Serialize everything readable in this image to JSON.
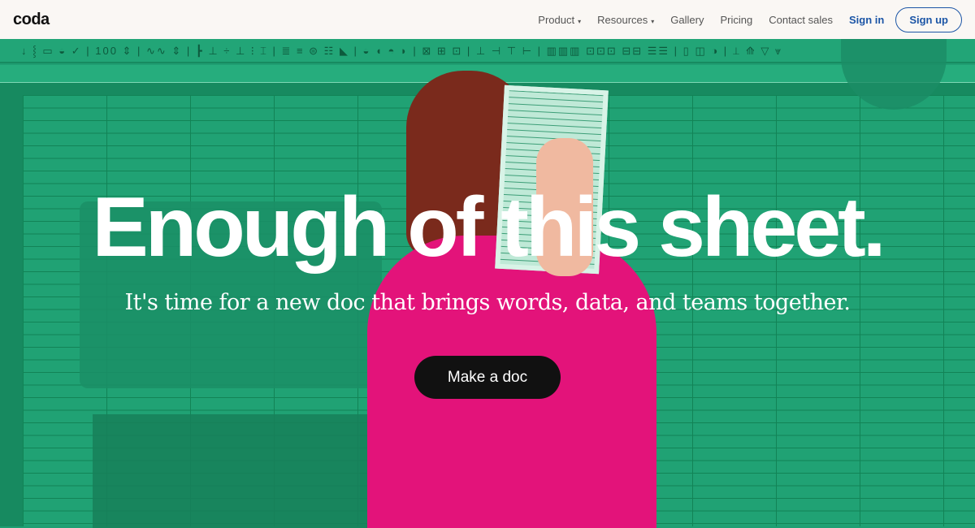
{
  "nav": {
    "logo": "coda",
    "items": [
      {
        "label": "Product",
        "caret": "▾"
      },
      {
        "label": "Resources",
        "caret": "▾"
      },
      {
        "label": "Gallery"
      },
      {
        "label": "Pricing"
      },
      {
        "label": "Contact sales"
      }
    ],
    "sign_in": "Sign in",
    "sign_up": "Sign up"
  },
  "toolbar": {
    "icons": "↓ ⸾ ▭ ◒ ✓ | 100 ⇕ | ∿∿ ⇕ | ┣ ⊥ ÷ ⊥ ⁝ ⌶ | ≣ ≡ ⊜ ☷ ◣ | ◒ ◖ ◓ ◗ | ⊠ ⊞ ⊡ | ⊥ ⊣ ⊤ ⊢ | ▥▥▥ ⊡⊡⊡ ⊟⊟ ☰☰ | ▯ ◫ ◑ | ⟂ ⟰ ▽ ⩔"
  },
  "hero": {
    "headline": "Enough of this sheet.",
    "subheadline": "It's time for a new doc that brings words, data, and teams together.",
    "cta": "Make a doc"
  },
  "colors": {
    "brand_green": "#1f9e72",
    "accent_blue": "#1b55a6",
    "sweater_pink": "#e3137a",
    "cta_black": "#111111"
  }
}
